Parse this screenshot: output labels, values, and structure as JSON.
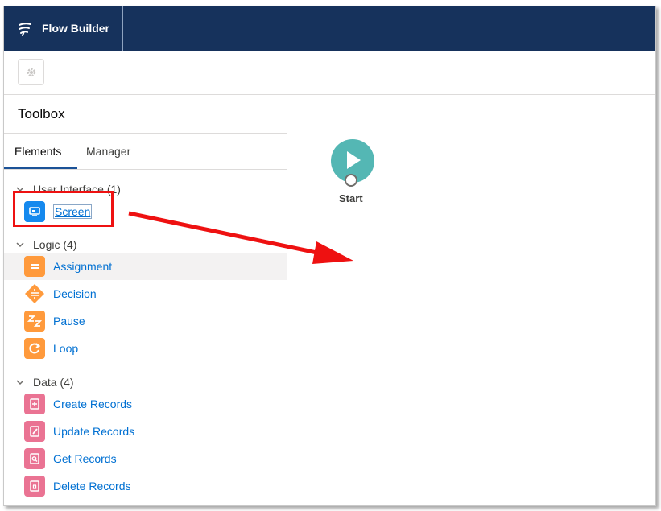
{
  "header": {
    "app_title": "Flow Builder",
    "logo_icon": "flow-builder-logo-icon",
    "background": "#16325c"
  },
  "toolbar": {
    "settings_icon": "gear-icon"
  },
  "toolbox": {
    "title": "Toolbox",
    "tabs": [
      {
        "label": "Elements",
        "active": true
      },
      {
        "label": "Manager",
        "active": false
      }
    ],
    "sections": [
      {
        "label": "User Interface (1)",
        "items": [
          {
            "label": "Screen",
            "icon": "screen-icon",
            "color": "#1589ee"
          }
        ]
      },
      {
        "label": "Logic (4)",
        "items": [
          {
            "label": "Assignment",
            "icon": "assignment-icon",
            "color": "#ff9a3c"
          },
          {
            "label": "Decision",
            "icon": "decision-icon",
            "color": "#ff9a3c"
          },
          {
            "label": "Pause",
            "icon": "pause-icon",
            "color": "#ff9a3c"
          },
          {
            "label": "Loop",
            "icon": "loop-icon",
            "color": "#ff9a3c"
          }
        ]
      },
      {
        "label": "Data (4)",
        "items": [
          {
            "label": "Create Records",
            "icon": "create-records-icon",
            "color": "#ea7393"
          },
          {
            "label": "Update Records",
            "icon": "update-records-icon",
            "color": "#ea7393"
          },
          {
            "label": "Get Records",
            "icon": "get-records-icon",
            "color": "#ea7393"
          },
          {
            "label": "Delete Records",
            "icon": "delete-records-icon",
            "color": "#ea7393"
          }
        ]
      }
    ]
  },
  "canvas": {
    "start_label": "Start",
    "start_color": "#54b7b4"
  },
  "annotation": {
    "color": "#ee1111"
  }
}
